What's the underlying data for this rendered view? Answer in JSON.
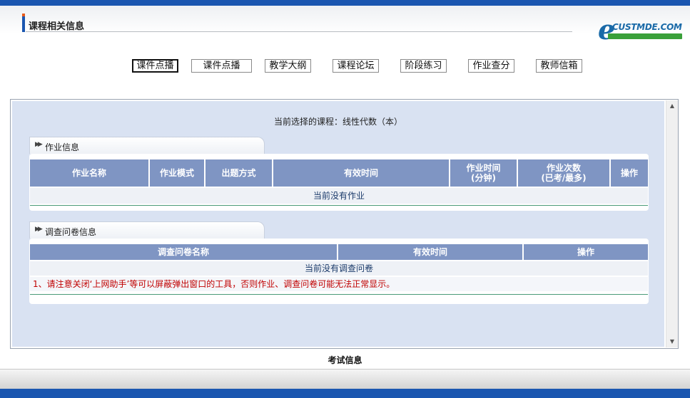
{
  "header": {
    "title": "课程相关信息",
    "logo_text": "CUSTMDE.COM"
  },
  "nav": [
    {
      "label": "课件点播",
      "active": true
    },
    {
      "label": "课件点播",
      "active": false
    },
    {
      "label": "教学大纲",
      "active": false
    },
    {
      "label": "课程论坛",
      "active": false
    },
    {
      "label": "阶段练习",
      "active": false
    },
    {
      "label": "作业查分",
      "active": false
    },
    {
      "label": "教师信箱",
      "active": false
    }
  ],
  "current_course": "当前选择的课程：线性代数（本）",
  "homework": {
    "section_title": "作业信息",
    "columns": [
      "作业名称",
      "作业模式",
      "出题方式",
      "有效时间",
      "作业时间\n(分钟)",
      "作业次数\n(已考/最多)",
      "操作"
    ],
    "empty_text": "当前没有作业"
  },
  "survey": {
    "section_title": "调查问卷信息",
    "columns": [
      "调查问卷名称",
      "有效时间",
      "操作"
    ],
    "empty_text": "当前没有调查问卷",
    "notice": "1、请注意关闭‘上网助手’等可以屏蔽弹出窗口的工具，否则作业、调查问卷可能无法正常显示。"
  },
  "exam_label": "考试信息",
  "colors": {
    "brand_blue": "#1a56b0",
    "header_cell": "#7f95c3",
    "content_bg": "#d9e2f2",
    "notice_red": "#c00000"
  }
}
